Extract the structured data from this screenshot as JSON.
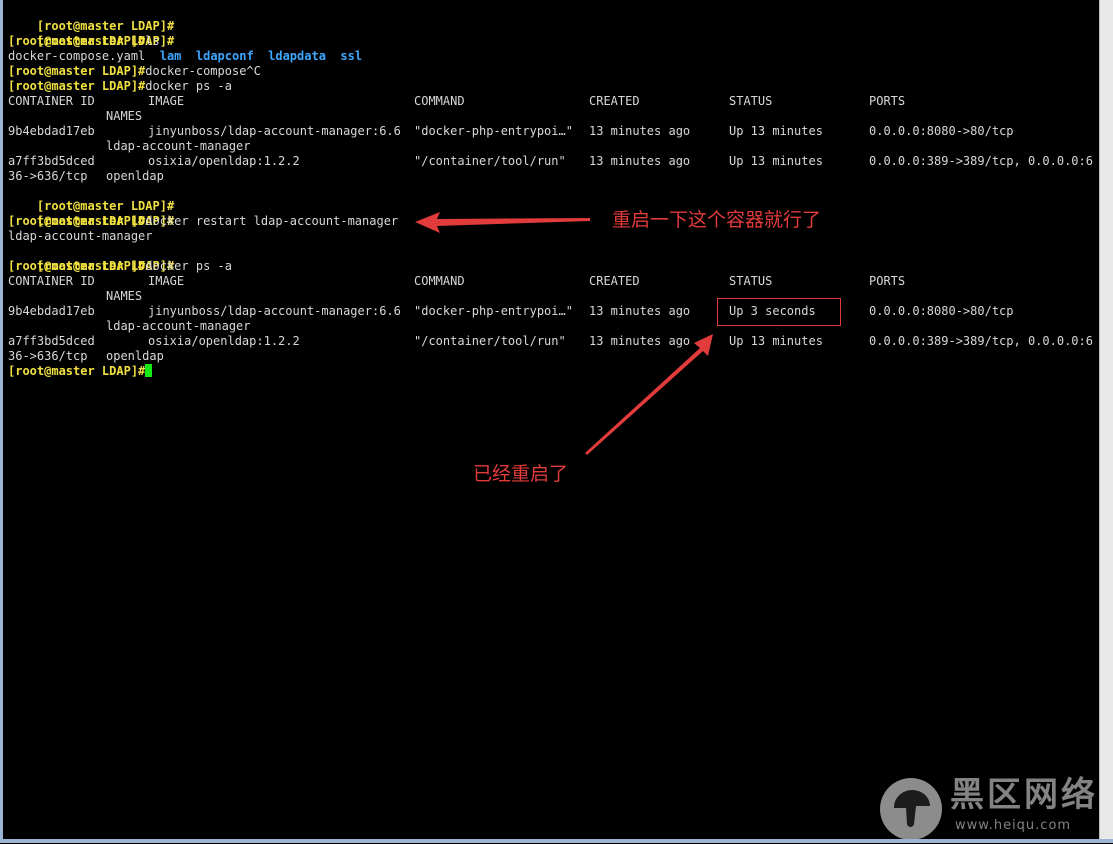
{
  "terminal": {
    "prompt": "[root@master LDAP]#",
    "commands": {
      "ls": "ls",
      "compose": "docker-compose^C",
      "ps1": "docker ps -a",
      "restart": "docker restart ldap-account-manager",
      "ps2": "docker ps -a"
    },
    "ls_output": {
      "file": "docker-compose.yaml",
      "dirs": [
        "lam",
        "ldapconf",
        "ldapdata",
        "ssl"
      ]
    },
    "restart_output": "ldap-account-manager",
    "table_headers": {
      "container_id": "CONTAINER ID",
      "image": "IMAGE",
      "command": "COMMAND",
      "created": "CREATED",
      "status": "STATUS",
      "ports": "PORTS",
      "names": "NAMES"
    },
    "ps1_rows": [
      {
        "container_id": "9b4ebdad17eb",
        "image": "jinyunboss/ldap-account-manager:6.6",
        "command": "\"docker-php-entrypoi…\"",
        "created": "13 minutes ago",
        "status": "Up 13 minutes",
        "ports": "0.0.0.0:8080->80/tcp",
        "names": "ldap-account-manager"
      },
      {
        "container_id": "a7ff3bd5dced",
        "image": "osixia/openldap:1.2.2",
        "command": "\"/container/tool/run\"",
        "created": "13 minutes ago",
        "status": "Up 13 minutes",
        "ports": "0.0.0.0:389->389/tcp, 0.0.0.0:6",
        "ports_wrap": "36->636/tcp",
        "names": "openldap"
      }
    ],
    "ps2_rows": [
      {
        "container_id": "9b4ebdad17eb",
        "image": "jinyunboss/ldap-account-manager:6.6",
        "command": "\"docker-php-entrypoi…\"",
        "created": "13 minutes ago",
        "status": "Up 3 seconds",
        "ports": "0.0.0.0:8080->80/tcp",
        "names": "ldap-account-manager"
      },
      {
        "container_id": "a7ff3bd5dced",
        "image": "osixia/openldap:1.2.2",
        "command": "\"/container/tool/run\"",
        "created": "13 minutes ago",
        "status": "Up 13 minutes",
        "ports": "0.0.0.0:389->389/tcp, 0.0.0.0:6",
        "ports_wrap": "36->636/tcp",
        "names": "openldap"
      }
    ]
  },
  "annotations": {
    "restart_note": "重启一下这个容器就行了",
    "restarted_note": "已经重启了"
  },
  "watermark": {
    "text": "黑区网络",
    "url": "www.heiqu.com"
  },
  "colors": {
    "background": "#000000",
    "prompt": "#f0e040",
    "directory": "#3da7ff",
    "annotation": "#e23b3b",
    "cursor": "#17e817"
  }
}
